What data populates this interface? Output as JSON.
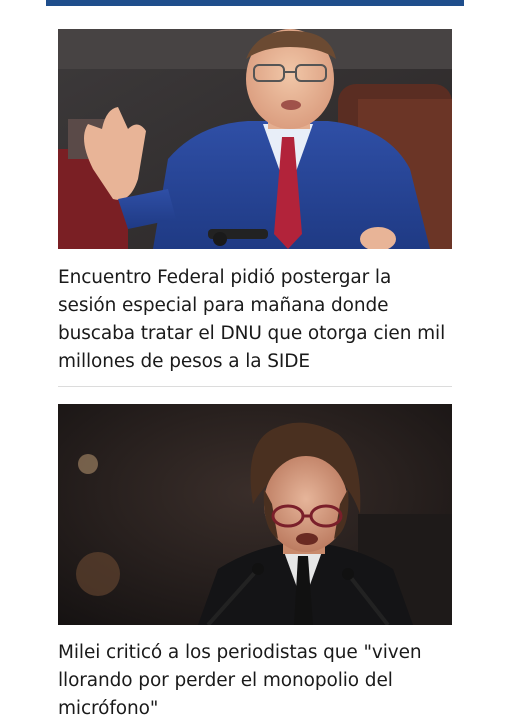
{
  "articles": [
    {
      "headline": "Encuentro Federal pidió postergar la sesión especial para mañana donde buscaba tratar el DNU que otorga cien mil millones de pesos a la SIDE",
      "image_subject": "legislator-speaking-photo"
    },
    {
      "headline": "Milei criticó a los periodistas que \"viven llorando por perder el monopolio del micrófono\"",
      "image_subject": "milei-speaking-photo"
    }
  ],
  "colors": {
    "accent_bar": "#1f4e8c",
    "divider": "#dcdcdc",
    "text": "#1a1a1a"
  }
}
